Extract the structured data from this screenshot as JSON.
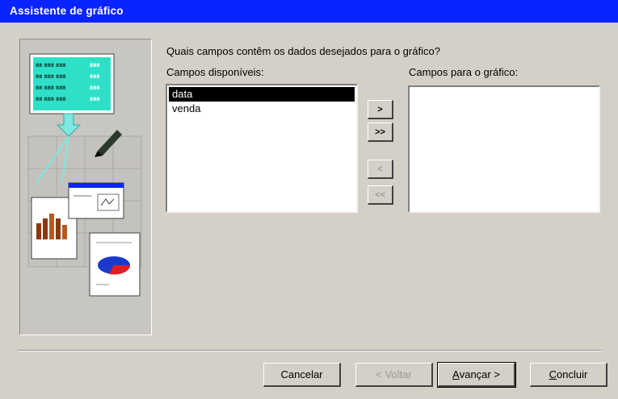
{
  "window": {
    "title": "Assistente de gráfico"
  },
  "prompt": {
    "question": "Quais campos contêm os dados desejados para o gráfico?"
  },
  "available_fields": {
    "label": "Campos disponíveis:",
    "items": [
      "data",
      "venda"
    ],
    "selected_index": 0
  },
  "chart_fields": {
    "label": "Campos para o gráfico:",
    "items": []
  },
  "move_buttons": {
    "add_one": ">",
    "add_all": ">>",
    "remove_one": "<",
    "remove_all": "<<"
  },
  "footer": {
    "cancel": "Cancelar",
    "back": "< Voltar",
    "next_prefix": "A",
    "next_rest": "vançar >",
    "finish_prefix": "C",
    "finish_rest": "oncluir"
  },
  "colors": {
    "titlebar": "#0a24ff",
    "window": "#d4d0c8",
    "selection": "#000000"
  }
}
